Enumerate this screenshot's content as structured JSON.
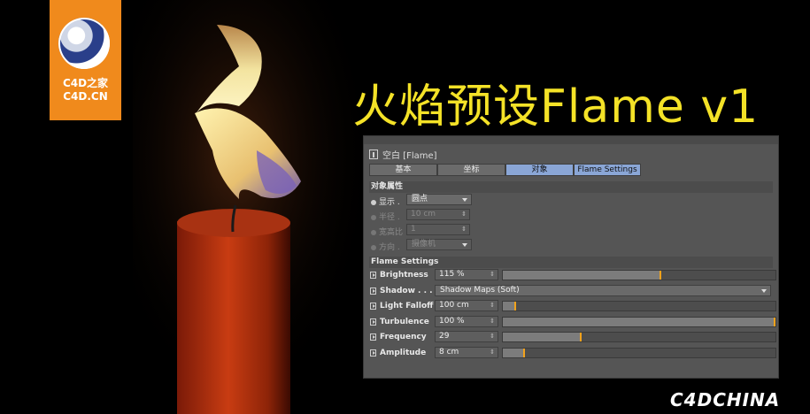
{
  "logo": {
    "line1": "C4D之家",
    "line2": "C4D.CN"
  },
  "title": "火焰预设Flame v1",
  "panel": {
    "object_title": "空白 [Flame]",
    "tabs": [
      {
        "label": "基本",
        "active": false
      },
      {
        "label": "坐标",
        "active": false
      },
      {
        "label": "对象",
        "active": true
      },
      {
        "label": "Flame Settings",
        "active": true
      }
    ],
    "object_props": {
      "section": "对象属性",
      "display_label": "显示",
      "display_value": "圆点",
      "radius_label": "半径",
      "radius_value": "10 cm",
      "aspect_label": "宽高比",
      "aspect_value": "1",
      "orient_label": "方向",
      "orient_value": "摄像机"
    },
    "flame_settings": {
      "section": "Flame Settings",
      "rows": [
        {
          "label": "Brightness",
          "value": "115 %",
          "fill": 0.58
        },
        {
          "label": "Shadow",
          "value": "Shadow Maps (Soft)",
          "fill": null
        },
        {
          "label": "Light Falloff",
          "value": "100 cm",
          "fill": 0.05
        },
        {
          "label": "Turbulence",
          "value": "100 %",
          "fill": 1.0
        },
        {
          "label": "Frequency",
          "value": "29",
          "fill": 0.29
        },
        {
          "label": "Amplitude",
          "value": "8 cm",
          "fill": 0.08
        }
      ]
    }
  },
  "watermark": "C4DCHINA",
  "colors": {
    "accent_orange": "#f08a1c",
    "title_yellow": "#f4e227",
    "tab_active": "#8aa6d6",
    "slider_knob": "#f2a21c"
  }
}
